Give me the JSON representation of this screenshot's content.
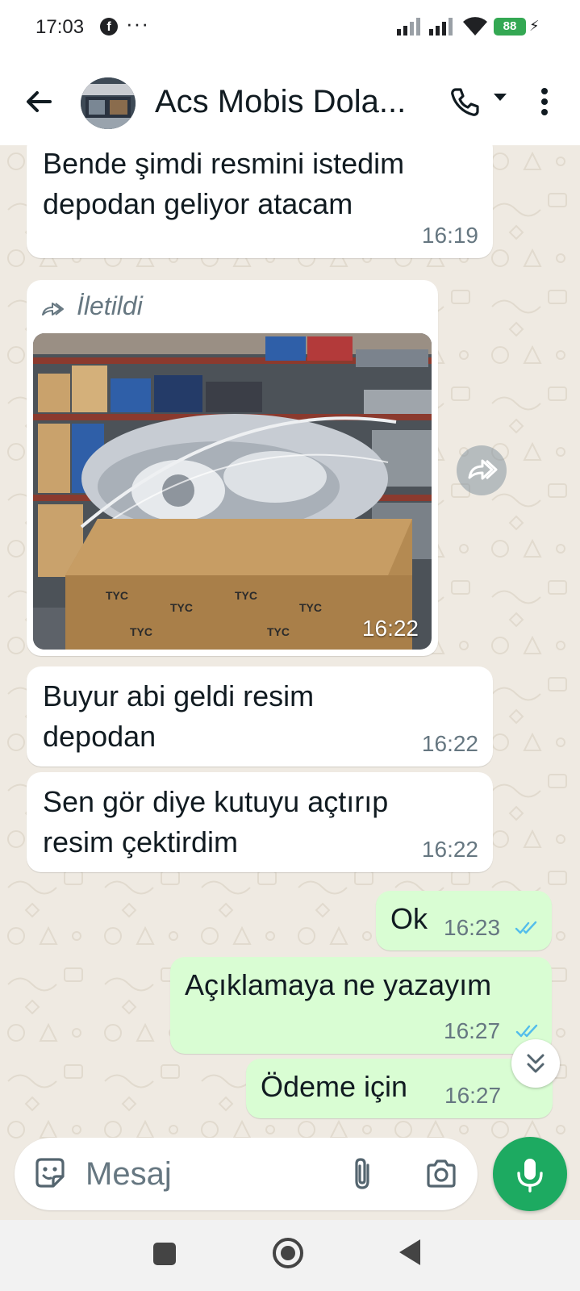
{
  "status_bar": {
    "time": "17:03",
    "overflow_dots": "···",
    "battery_level": "88",
    "icons": [
      "facebook-icon",
      "signal-icon",
      "signal-icon",
      "wifi-icon",
      "battery-icon",
      "charging-icon"
    ]
  },
  "header": {
    "title": "Acs Mobis Dola...",
    "icons": [
      "back-arrow-icon",
      "avatar",
      "phone-icon",
      "dropdown-icon",
      "more-vert-icon"
    ]
  },
  "messages": [
    {
      "direction": "incoming",
      "text": "Bende şimdi resmini istedim depodan geliyor atacam",
      "time": "16:19"
    },
    {
      "direction": "incoming",
      "type": "image",
      "forwarded_label": "İletildi",
      "time": "16:22"
    },
    {
      "direction": "incoming",
      "text": "Buyur abi geldi resim depodan",
      "time": "16:22"
    },
    {
      "direction": "incoming",
      "text": "Sen gör diye kutuyu açtırıp resim çektirdim",
      "time": "16:22"
    },
    {
      "direction": "outgoing",
      "text": "Ok",
      "time": "16:23",
      "status": "read"
    },
    {
      "direction": "outgoing",
      "text": "Açıklamaya ne yazayım",
      "time": "16:27",
      "status": "read"
    },
    {
      "direction": "outgoing",
      "text": "Ödeme için",
      "time": "16:27",
      "status": "read"
    }
  ],
  "composer": {
    "placeholder": "Mesaj",
    "icons": [
      "emoji-icon",
      "attach-icon",
      "camera-icon",
      "mic-icon"
    ]
  },
  "colors": {
    "accent_green": "#1daa61",
    "outgoing_bubble": "#d9fdd3",
    "incoming_bubble": "#ffffff",
    "read_ticks": "#53bdeb",
    "chat_background": "#efeae2"
  }
}
